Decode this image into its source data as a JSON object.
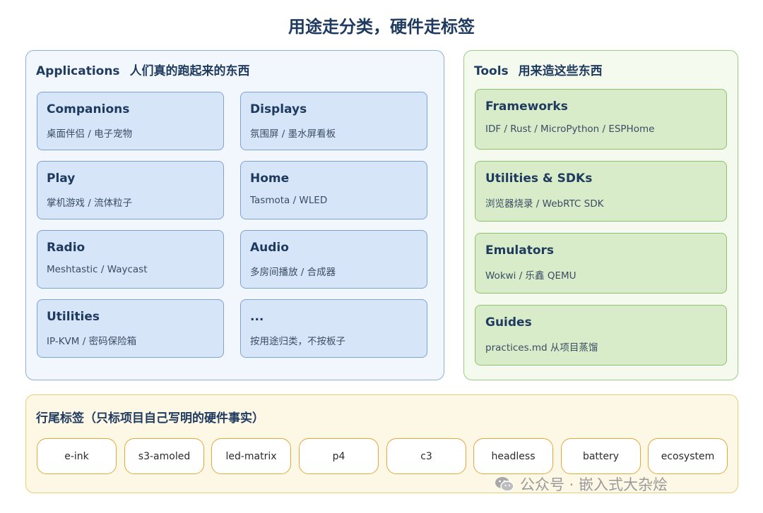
{
  "title": "用途走分类，硬件走标签",
  "applications": {
    "label": "Applications",
    "subtitle": "人们真的跑起来的东西",
    "cards": [
      {
        "name": "Companions",
        "desc": "桌面伴侣 / 电子宠物"
      },
      {
        "name": "Displays",
        "desc": "氛围屏 / 墨水屏看板"
      },
      {
        "name": "Play",
        "desc": "掌机游戏 / 流体粒子"
      },
      {
        "name": "Home",
        "desc": "Tasmota / WLED"
      },
      {
        "name": "Radio",
        "desc": "Meshtastic / Waycast"
      },
      {
        "name": "Audio",
        "desc": "多房间播放 / 合成器"
      },
      {
        "name": "Utilities",
        "desc": "IP-KVM / 密码保险箱"
      },
      {
        "name": "...",
        "desc": "按用途归类，不按板子"
      }
    ]
  },
  "tools": {
    "label": "Tools",
    "subtitle": "用来造这些东西",
    "cards": [
      {
        "name": "Frameworks",
        "desc": "IDF / Rust / MicroPython / ESPHome"
      },
      {
        "name": "Utilities & SDKs",
        "desc": "浏览器烧录 / WebRTC SDK"
      },
      {
        "name": "Emulators",
        "desc": "Wokwi / 乐鑫 QEMU"
      },
      {
        "name": "Guides",
        "desc": "practices.md 从项目蒸馏"
      }
    ]
  },
  "tags": {
    "title": "行尾标签（只标项目自己写明的硬件事实）",
    "items": [
      "e-ink",
      "s3-amoled",
      "led-matrix",
      "p4",
      "c3",
      "headless",
      "battery",
      "ecosystem"
    ]
  },
  "watermark": {
    "text": "公众号 · 嵌入式大杂烩"
  },
  "colors": {
    "apps_fill": "#f2f7fd",
    "apps_border": "#8eb0d8",
    "tools_fill": "#f5faef",
    "tools_border": "#9ecb84",
    "tags_fill": "#fdf8e6",
    "tag_border": "#e2a93a",
    "text": "#1f3a5f"
  }
}
